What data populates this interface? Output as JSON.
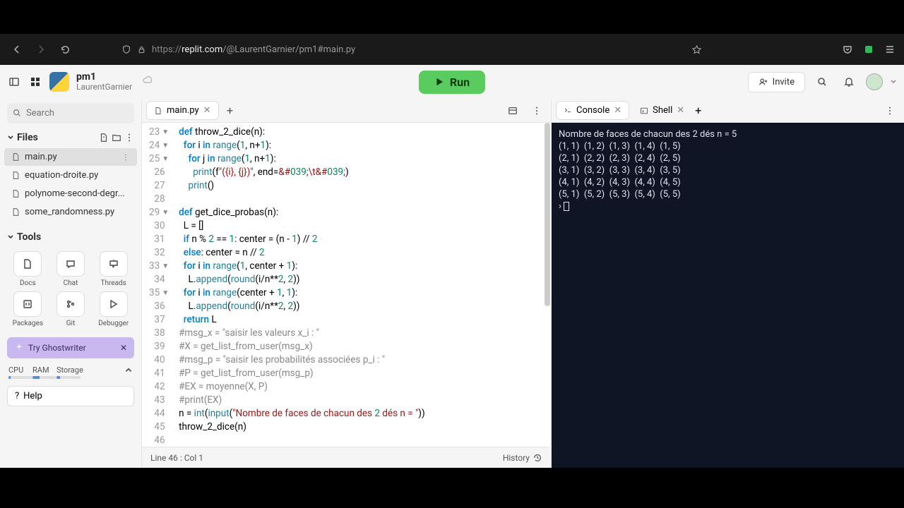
{
  "browser": {
    "url_proto": "https://",
    "url_host": "replit.com",
    "url_path": "/@LaurentGarnier/pm1#main.py"
  },
  "header": {
    "project": "pm1",
    "owner": "LaurentGarnier",
    "run": "Run",
    "invite": "Invite"
  },
  "sidebar": {
    "search_placeholder": "Search",
    "files_label": "Files",
    "files": [
      "main.py",
      "equation-droite.py",
      "polynome-second-degr...",
      "some_randomness.py"
    ],
    "tools_label": "Tools",
    "tools": [
      "Docs",
      "Chat",
      "Threads",
      "Packages",
      "Git",
      "Debugger"
    ],
    "ghost": "Try Ghostwriter",
    "stats": [
      "CPU",
      "RAM",
      "Storage"
    ],
    "stat_levels": [
      8,
      28,
      14
    ],
    "help": "Help"
  },
  "editor": {
    "tab": "main.py",
    "lines_start": 23,
    "folds": {
      "23": true,
      "24": true,
      "25": true,
      "29": true,
      "33": true,
      "35": true
    },
    "code": [
      "def throw_2_dice(n):",
      "  for i in range(1, n+1):",
      "    for j in range(1, n+1):",
      "      print(f\"({i}, {j})\", end='\\t')",
      "    print()",
      "",
      "def get_dice_probas(n):",
      "  L = []",
      "  if n % 2 == 1: center = (n - 1) // 2",
      "  else: center = n // 2",
      "  for i in range(1, center + 1):",
      "    L.append(round(i/n**2, 2))",
      "  for i in range(center + 1, 1):",
      "    L.append(round(i/n**2, 2))",
      "  return L",
      "#msg_x = \"saisir les valeurs x_i : \"",
      "#X = get_list_from_user(msg_x)",
      "#msg_p = \"saisir les probabilités associées p_i : \"",
      "#P = get_list_from_user(msg_p)",
      "#EX = moyenne(X, P)",
      "#print(EX)",
      "n = int(input(\"Nombre de faces de chacun des 2 dés n = \"))",
      "throw_2_dice(n)",
      ""
    ],
    "status": "Line 46 : Col 1",
    "history": "History"
  },
  "console": {
    "tab_console": "Console",
    "tab_shell": "Shell",
    "output": "Nombre de faces de chacun des 2 dés n = 5\n(1, 1)  (1, 2)  (1, 3)  (1, 4)  (1, 5)\n(2, 1)  (2, 2)  (2, 3)  (2, 4)  (2, 5)\n(3, 1)  (3, 2)  (3, 3)  (3, 4)  (3, 5)\n(4, 1)  (4, 2)  (4, 3)  (4, 4)  (4, 5)\n(5, 1)  (5, 2)  (5, 3)  (5, 4)  (5, 5)",
    "prompt": "› "
  }
}
